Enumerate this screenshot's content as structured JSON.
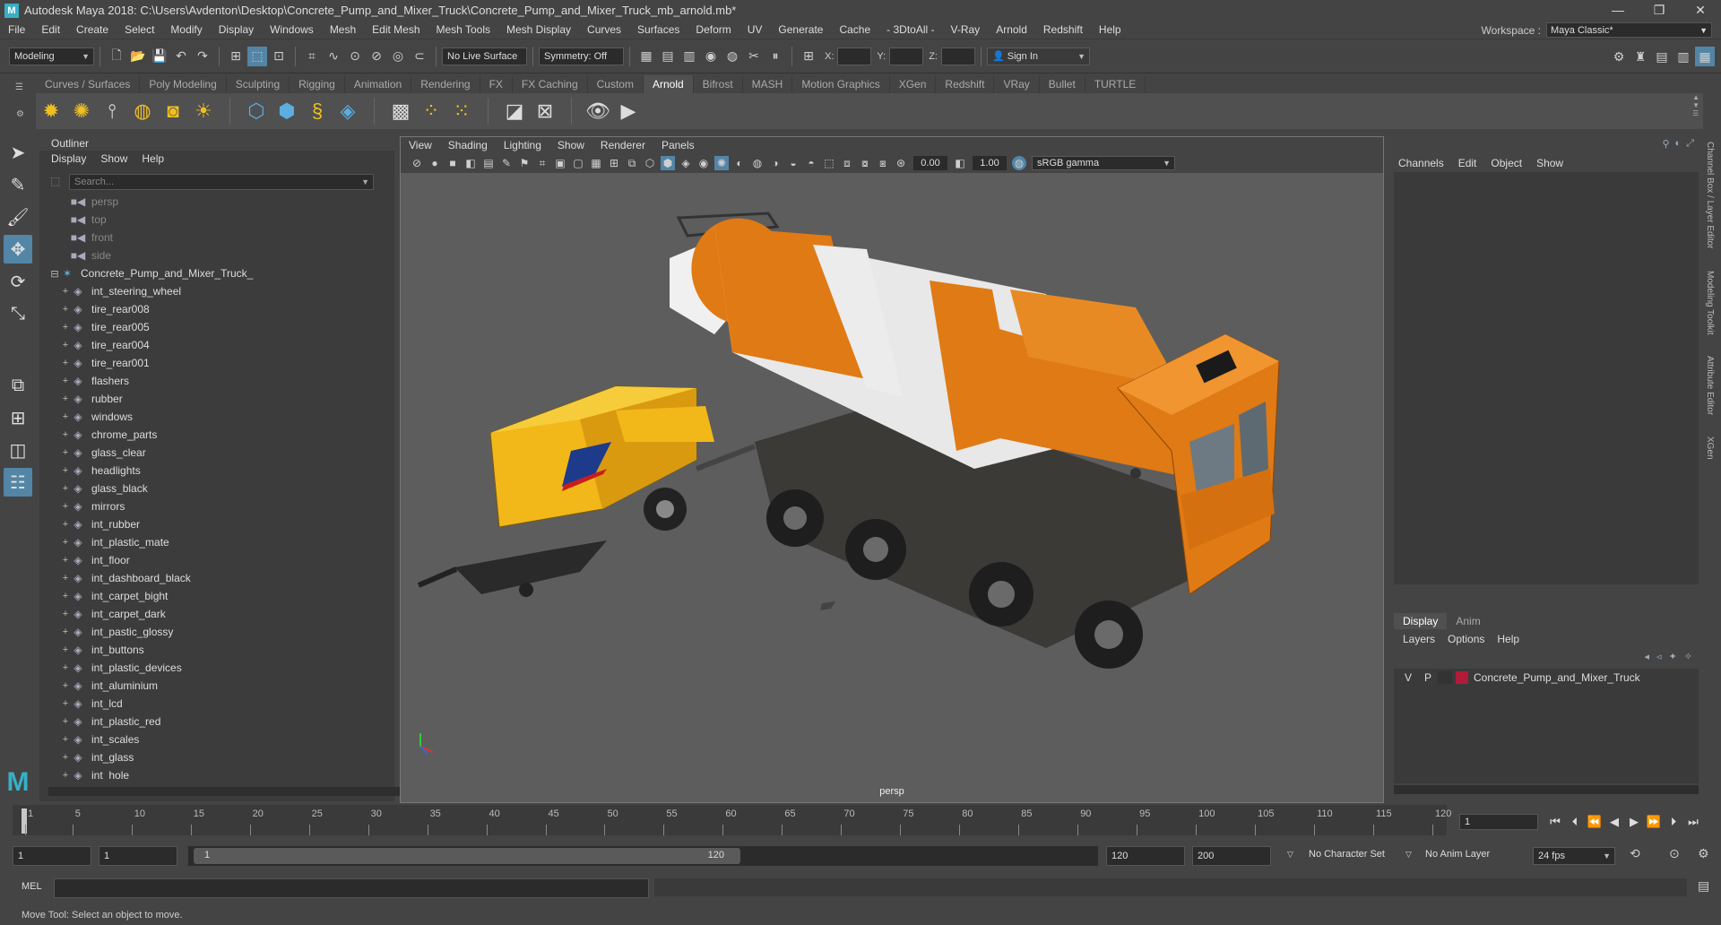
{
  "window": {
    "title": "Autodesk Maya 2018: C:\\Users\\Avdenton\\Desktop\\Concrete_Pump_and_Mixer_Truck\\Concrete_Pump_and_Mixer_Truck_mb_arnold.mb*",
    "logo": "M",
    "minimize": "—",
    "maximize": "❐",
    "close": "✕"
  },
  "menus": [
    "File",
    "Edit",
    "Create",
    "Select",
    "Modify",
    "Display",
    "Windows",
    "Mesh",
    "Edit Mesh",
    "Mesh Tools",
    "Mesh Display",
    "Curves",
    "Surfaces",
    "Deform",
    "UV",
    "Generate",
    "Cache",
    "- 3DtoAll -",
    "V-Ray",
    "Arnold",
    "Redshift",
    "Help"
  ],
  "workspace": {
    "label": "Workspace :",
    "value": "Maya Classic*"
  },
  "statusline": {
    "mode": "Modeling",
    "live_surface": "No Live Surface",
    "symmetry": "Symmetry: Off",
    "x_label": "X:",
    "y_label": "Y:",
    "z_label": "Z:",
    "sign_in": "Sign In"
  },
  "shelf": {
    "tabs": [
      "Curves / Surfaces",
      "Poly Modeling",
      "Sculpting",
      "Rigging",
      "Animation",
      "Rendering",
      "FX",
      "FX Caching",
      "Custom",
      "Arnold",
      "Bifrost",
      "MASH",
      "Motion Graphics",
      "XGen",
      "Redshift",
      "VRay",
      "Bullet",
      "TURTLE"
    ],
    "active": "Arnold"
  },
  "outliner": {
    "title": "Outliner",
    "menu": [
      "Display",
      "Show",
      "Help"
    ],
    "search_placeholder": "Search...",
    "cameras": [
      "persp",
      "top",
      "front",
      "side"
    ],
    "root": "Concrete_Pump_and_Mixer_Truck_",
    "children": [
      "int_steering_wheel",
      "tire_rear008",
      "tire_rear005",
      "tire_rear004",
      "tire_rear001",
      "flashers",
      "rubber",
      "windows",
      "chrome_parts",
      "glass_clear",
      "headlights",
      "glass_black",
      "mirrors",
      "int_rubber",
      "int_plastic_mate",
      "int_floor",
      "int_dashboard_black",
      "int_carpet_bight",
      "int_carpet_dark",
      "int_pastic_glossy",
      "int_buttons",
      "int_plastic_devices",
      "int_aluminium",
      "int_lcd",
      "int_plastic_red",
      "int_scales",
      "int_glass",
      "int_hole"
    ]
  },
  "viewport": {
    "menu": [
      "View",
      "Shading",
      "Lighting",
      "Show",
      "Renderer",
      "Panels"
    ],
    "exposure": "0.00",
    "gamma": "1.00",
    "color_space": "sRGB gamma",
    "camera": "persp"
  },
  "channelbox": {
    "menu": [
      "Channels",
      "Edit",
      "Object",
      "Show"
    ],
    "layer_tabs": [
      "Display",
      "Anim"
    ],
    "layer_menu": [
      "Layers",
      "Options",
      "Help"
    ],
    "layer": {
      "v": "V",
      "p": "P",
      "name": "Concrete_Pump_and_Mixer_Truck",
      "color": "#b21a3a"
    }
  },
  "side_tabs": [
    "Channel Box / Layer Editor",
    "Modeling Toolkit",
    "Attribute Editor",
    "XGen"
  ],
  "timeline": {
    "ticks": [
      "1",
      "5",
      "10",
      "15",
      "20",
      "25",
      "30",
      "35",
      "40",
      "45",
      "50",
      "55",
      "60",
      "65",
      "70",
      "75",
      "80",
      "85",
      "90",
      "95",
      "100",
      "105",
      "110",
      "115",
      "120"
    ],
    "current": "1"
  },
  "range": {
    "start": "1",
    "playback_start": "1",
    "handle_start": "1",
    "handle_end": "120",
    "playback_end": "120",
    "end": "200",
    "character_set": "No Character Set",
    "anim_layer": "No Anim Layer",
    "fps": "24 fps"
  },
  "command": {
    "lang": "MEL",
    "help": "Move Tool: Select an object to move."
  },
  "colors": {
    "accent": "#5285a6",
    "truck_orange": "#e07a14",
    "drum_white": "#e8e8e8",
    "pump_yellow": "#f2b81a",
    "chassis": "#3c3a36"
  }
}
